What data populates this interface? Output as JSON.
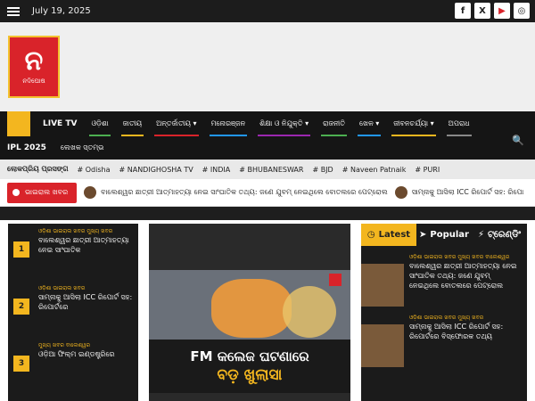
{
  "topbar": {
    "date": "July 19, 2025",
    "social": [
      "f",
      "X",
      "▶",
      "◎"
    ]
  },
  "brand": {
    "logo_text": "ନଦିଘୋଷ",
    "logo_glyph": "ନ"
  },
  "nav": {
    "items": [
      {
        "label": "LIVE TV",
        "color": ""
      },
      {
        "label": "ଓଡ଼ିଶା",
        "color": "#4caf50"
      },
      {
        "label": "ଜାତୀୟ",
        "color": "#f3b61f"
      },
      {
        "label": "ଅନ୍ତର୍ଜାତୀୟ ▾",
        "color": "#d9232a"
      },
      {
        "label": "ମନୋରଞ୍ଜନ",
        "color": "#2196f3"
      },
      {
        "label": "ଶିକ୍ଷା ଓ ନିଯୁକ୍ତି ▾",
        "color": "#9c27b0"
      },
      {
        "label": "ରାଜନୀତି",
        "color": "#4caf50"
      },
      {
        "label": "ଖେଳ ▾",
        "color": "#2196f3"
      },
      {
        "label": "ଜୀବନଚର୍ଯ୍ୟା ▾",
        "color": "#f3b61f"
      },
      {
        "label": "ଅପରାଧ",
        "color": "#888888"
      }
    ],
    "row2": [
      "IPL 2025",
      "ଲେଖକ ସ୍ତମ୍ଭ"
    ]
  },
  "tags": {
    "label": "ଲୋକପ୍ରିୟ ପ୍ରସଙ୍ଗ",
    "items": [
      "# Odisha",
      "# NANDIGHOSHA TV",
      "# INDIA",
      "# BHUBANESWAR",
      "# BJD",
      "# Naveen Patnaik",
      "# PURI"
    ]
  },
  "breaking": {
    "label": "ଭାଇରାଲ ଖବର",
    "items": [
      {
        "num": "1",
        "text": "ବାଲେଶ୍ୱର ଛାତ୍ରୀ ଆତ୍ମାହତ୍ୟା ନେଇ ସାଂଘାତିକ ତଥ୍ୟ: ଜଣେ ଯୁବମ୍ ନେଇଥିଲେ ବୋତଲରେ ପେଟ୍ରୋଲ"
      },
      {
        "num": "2",
        "text": "ସାମ୍ନାକୁ ଆସିଲା ICC ରିପୋର୍ଟ ସହ: ରିପୋ"
      }
    ]
  },
  "left_list": [
    {
      "num": "1",
      "cats": "ଓଡ଼ିଶା  ଭାଇରାଲ ଖବର  ମୁଖ୍ୟ ଖବର",
      "title": "ବାଲେଶ୍ୱର ଛାତ୍ରୀ ଆତ୍ମାହତ୍ୟା ନେଇ ସାଂଘାତିକ"
    },
    {
      "num": "2",
      "cats": "ଓଡ଼ିଶା  ଭାଇରାଲ ଖବର",
      "title": "ସାମ୍ନାକୁ ଆସିଲା ICC ରିପୋର୍ଟ ସହ: ରିପୋର୍ଟରେ"
    },
    {
      "num": "3",
      "cats": "ମୁଖ୍ୟ ଖବର  ବାଲେଶ୍ୱର",
      "title": "ଓଡ଼ିଆ ଫିଲ୍ମ ଇଣ୍ଡଷ୍ଟ୍ରିରେ"
    }
  ],
  "hero": {
    "line1": "FM କଲେଜ ଘଟଣାରେ",
    "line2": "ବଡ଼ ଖୁଲାସା"
  },
  "right_panel": {
    "tabs": [
      "Latest",
      "Popular",
      "ଟ୍ରେଣ୍ଡିଂ"
    ],
    "items": [
      {
        "cats": "ଓଡ଼ିଶା  ଭାଇରାଲ ଖବର  ମୁଖ୍ୟ ଖବର  ବାଲେଶ୍ୱର",
        "title": "ବାଲେଶ୍ୱର ଛାତ୍ରୀ ଆତ୍ମାହତ୍ୟା ନେଇ ସାଂଘାତିକ ତଥ୍ୟ: ଜଣେ ଯୁବମ୍ ନେଇଥିଲେ ବୋତଲରେ ପେଟ୍ରୋଲ"
      },
      {
        "cats": "ଓଡ଼ିଶା  ଭାଇରାଲ ଖବର  ମୁଖ୍ୟ ଖବର",
        "title": "ସାମ୍ନାକୁ ଆସିଲା ICC ରିପୋର୍ଟ ସହ: ରିପୋର୍ଟରେ ବିସ୍ଫୋରକ ତଥ୍ୟ"
      }
    ]
  }
}
